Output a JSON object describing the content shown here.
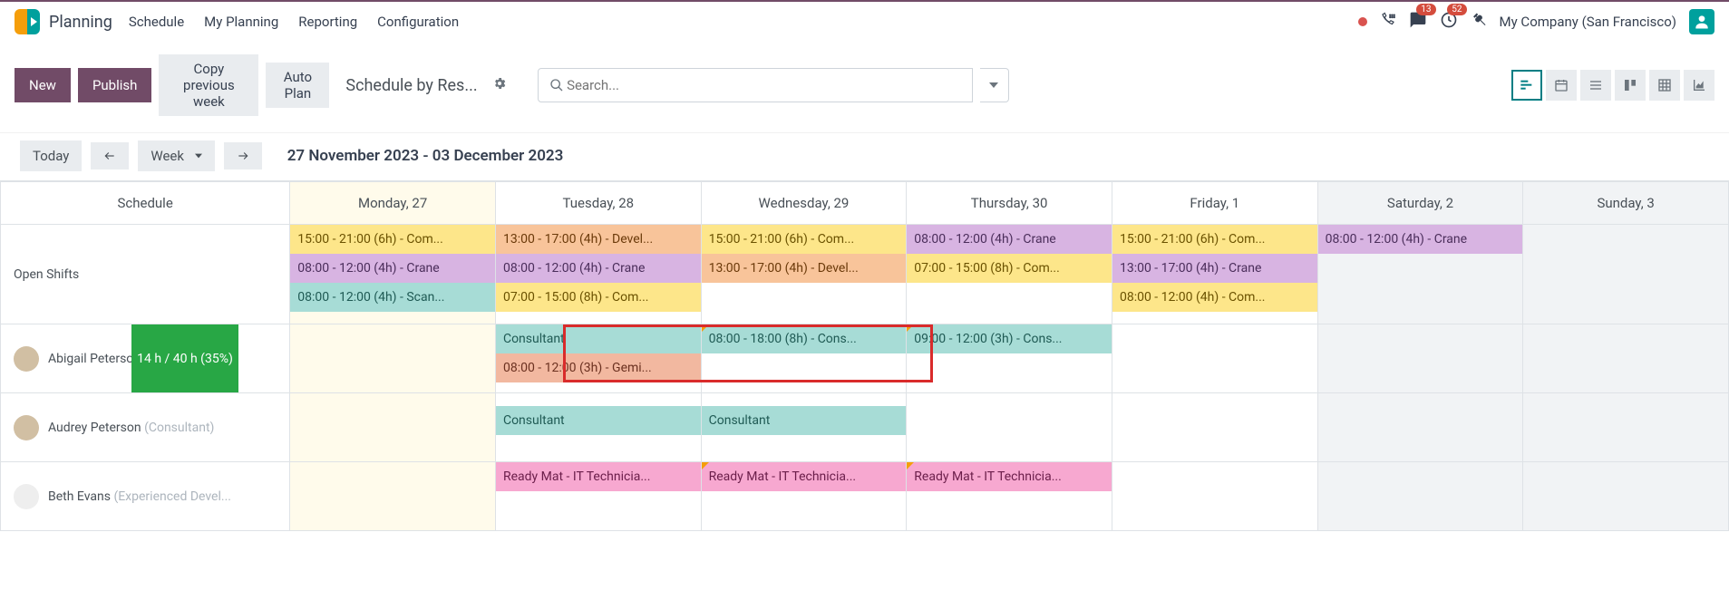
{
  "app": {
    "name": "Planning"
  },
  "nav": {
    "items": [
      "Schedule",
      "My Planning",
      "Reporting",
      "Configuration"
    ]
  },
  "tray": {
    "messages_badge": "13",
    "activities_badge": "52",
    "company": "My Company (San Francisco)"
  },
  "actions": {
    "new": "New",
    "publish": "Publish",
    "copy_prev": "Copy previous week",
    "auto_plan": "Auto Plan",
    "breadcrumb": "Schedule by Res...",
    "search_placeholder": "Search..."
  },
  "controls": {
    "today": "Today",
    "scale": "Week",
    "range": "27 November 2023 - 03 December 2023"
  },
  "headers": {
    "schedule": "Schedule",
    "days": [
      "Monday, 27",
      "Tuesday, 28",
      "Wednesday, 29",
      "Thursday, 30",
      "Friday, 1",
      "Saturday, 2",
      "Sunday, 3"
    ]
  },
  "rows": {
    "open": {
      "label": "Open Shifts",
      "cells": [
        [
          {
            "t": "15:00 - 21:00 (6h) - Com...",
            "c": "c-yellow"
          },
          {
            "t": "08:00 - 12:00 (4h) - Crane",
            "c": "c-purple"
          },
          {
            "t": "08:00 - 12:00 (4h) - Scan...",
            "c": "c-teal"
          }
        ],
        [
          {
            "t": "13:00 - 17:00 (4h) - Devel...",
            "c": "c-orange"
          },
          {
            "t": "08:00 - 12:00 (4h) - Crane",
            "c": "c-purple"
          },
          {
            "t": "07:00 - 15:00 (8h) - Com...",
            "c": "c-yellow"
          }
        ],
        [
          {
            "t": "15:00 - 21:00 (6h) - Com...",
            "c": "c-yellow"
          },
          {
            "t": "13:00 - 17:00 (4h) - Devel...",
            "c": "c-orange"
          }
        ],
        [
          {
            "t": "08:00 - 12:00 (4h) - Crane",
            "c": "c-purple"
          },
          {
            "t": "07:00 - 15:00 (8h) - Com...",
            "c": "c-yellow"
          }
        ],
        [
          {
            "t": "15:00 - 21:00 (6h) - Com...",
            "c": "c-yellow"
          },
          {
            "t": "13:00 - 17:00 (4h) - Crane",
            "c": "c-purple"
          },
          {
            "t": "08:00 - 12:00 (4h) - Com...",
            "c": "c-yellow"
          }
        ],
        [
          {
            "t": "08:00 - 12:00 (4h) - Crane",
            "c": "c-purple"
          }
        ],
        []
      ]
    },
    "abigail": {
      "name": "Abigail Peterso",
      "progress": "14 h / 40 h (35%)",
      "cells": [
        [],
        [
          {
            "t": "Consultant",
            "c": "c-teal"
          },
          {
            "t": "08:00 - 12:00 (3h) - Gemi...",
            "c": "c-salmon"
          }
        ],
        [
          {
            "t": "08:00 - 18:00 (8h) - Cons...",
            "c": "c-teal",
            "corner": true
          }
        ],
        [
          {
            "t": "09:00 - 12:00 (3h) - Cons...",
            "c": "c-teal",
            "corner": true
          }
        ],
        [],
        [],
        []
      ]
    },
    "audrey": {
      "name": "Audrey Peterson",
      "role": "(Consultant)",
      "cells": [
        [],
        [
          {
            "t": "Consultant",
            "c": "c-teal"
          }
        ],
        [
          {
            "t": "Consultant",
            "c": "c-teal"
          }
        ],
        [],
        [],
        [],
        []
      ]
    },
    "beth": {
      "name": "Beth Evans",
      "role": "(Experienced Devel...",
      "cells": [
        [],
        [
          {
            "t": "Ready Mat - IT Technicia...",
            "c": "c-pink"
          }
        ],
        [
          {
            "t": "Ready Mat - IT Technicia...",
            "c": "c-pink",
            "corner": true
          }
        ],
        [
          {
            "t": "Ready Mat - IT Technicia...",
            "c": "c-pink",
            "corner": true
          }
        ],
        [],
        [],
        []
      ]
    }
  }
}
